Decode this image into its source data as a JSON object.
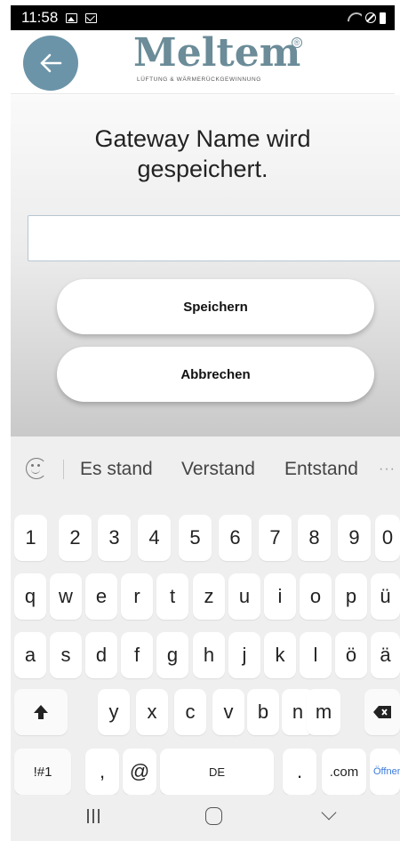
{
  "status_bar": {
    "time": "11:58",
    "icons": [
      "photo-icon",
      "mail-icon",
      "wifi-icon",
      "do-not-disturb-icon",
      "battery-icon"
    ]
  },
  "header": {
    "back_icon": "arrow-left-icon",
    "back_color": "#6b94a8",
    "logo_text": "Meltem",
    "logo_registered": "®",
    "logo_tagline": "LÜFTUNG & WÄRMERÜCKGEWINNUNG"
  },
  "dialog": {
    "title_line1": "Gateway Name wird",
    "title_line2": "gespeichert.",
    "name_input_value": "",
    "save_label": "Speichern",
    "cancel_label": "Abbrechen"
  },
  "keyboard": {
    "suggestions": [
      "Es stand",
      "Verstand",
      "Entstand"
    ],
    "number_row": [
      "1",
      "2",
      "3",
      "4",
      "5",
      "6",
      "7",
      "8",
      "9",
      "0"
    ],
    "row_q": [
      "q",
      "w",
      "e",
      "r",
      "t",
      "z",
      "u",
      "i",
      "o",
      "p",
      "ü"
    ],
    "row_a": [
      "a",
      "s",
      "d",
      "f",
      "g",
      "h",
      "j",
      "k",
      "l",
      "ö",
      "ä"
    ],
    "row_y": [
      "y",
      "x",
      "c",
      "v",
      "b",
      "n",
      "m"
    ],
    "symbols_label": "!#1",
    "comma_label": ",",
    "at_label": "@",
    "space_label": "DE",
    "period_label": ".",
    "dotcom_label": ".com",
    "enter_label": "Öffnen"
  }
}
